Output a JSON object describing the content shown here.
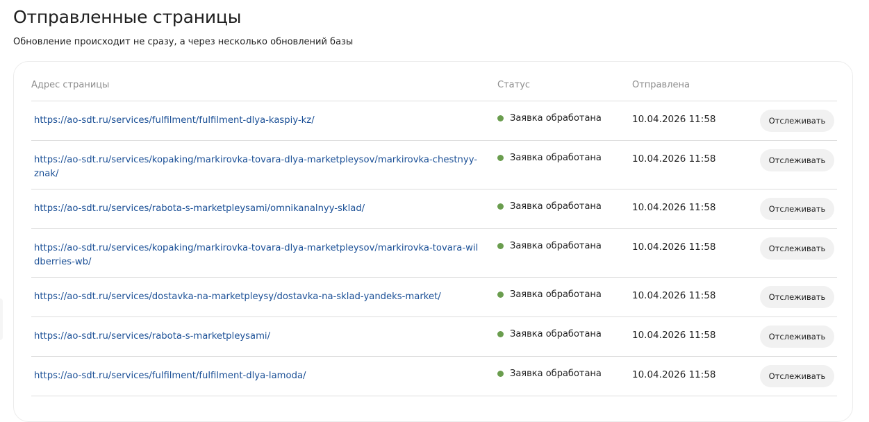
{
  "header": {
    "title": "Отправленные страницы",
    "subtitle": "Обновление происходит не сразу, а через несколько обновлений базы"
  },
  "table": {
    "columns": {
      "url": "Адрес страницы",
      "status": "Статус",
      "sent": "Отправлена"
    },
    "rows": [
      {
        "url": "https://ao-sdt.ru/services/fulfilment/fulfilment-dlya-kaspiy-kz/",
        "status": "Заявка обработана",
        "sent": "10.04.2026 11:58",
        "action": "Отслеживать",
        "lines": 1
      },
      {
        "url": "https://ao-sdt.ru/services/kopaking/markirovka-tovara-dlya-marketpleysov/markirovka-chestnyy-znak/",
        "status": "Заявка обработана",
        "sent": "10.04.2026 11:58",
        "action": "Отслеживать",
        "lines": 2
      },
      {
        "url": "https://ao-sdt.ru/services/rabota-s-marketpleysami/omnikanalnyy-sklad/",
        "status": "Заявка обработана",
        "sent": "10.04.2026 11:58",
        "action": "Отслеживать",
        "lines": 1
      },
      {
        "url": "https://ao-sdt.ru/services/kopaking/markirovka-tovara-dlya-marketpleysov/markirovka-tovara-wildberries-wb/",
        "status": "Заявка обработана",
        "sent": "10.04.2026 11:58",
        "action": "Отслеживать",
        "lines": 2
      },
      {
        "url": "https://ao-sdt.ru/services/dostavka-na-marketpleysy/dostavka-na-sklad-yandeks-market/",
        "status": "Заявка обработана",
        "sent": "10.04.2026 11:58",
        "action": "Отслеживать",
        "lines": 1
      },
      {
        "url": "https://ao-sdt.ru/services/rabota-s-marketpleysami/",
        "status": "Заявка обработана",
        "sent": "10.04.2026 11:58",
        "action": "Отслеживать",
        "lines": 1
      },
      {
        "url": "https://ao-sdt.ru/services/fulfilment/fulfilment-dlya-lamoda/",
        "status": "Заявка обработана",
        "sent": "10.04.2026 11:58",
        "action": "Отслеживать",
        "lines": 1
      }
    ]
  },
  "colors": {
    "link": "#1a4f96",
    "status_ok": "#6a9d4e",
    "button_bg": "#f1f1f1",
    "divider": "#dcdcdc"
  }
}
